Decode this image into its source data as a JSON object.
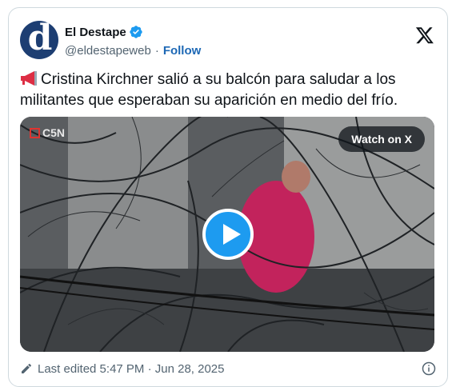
{
  "author": {
    "display_name": "El Destape",
    "handle": "@eldestapeweb",
    "follow_label": "Follow",
    "avatar_glyph": "d"
  },
  "tweet": {
    "text": "Cristina Kirchner salió a su balcón para saludar a los militantes que esperaban su aparición en medio del frío.",
    "emoji": "megaphone-icon"
  },
  "media": {
    "channel_label": "C5N",
    "watch_label": "Watch on X"
  },
  "footer": {
    "edited_label": "Last edited 5:47 PM · Jun 28, 2025"
  },
  "colors": {
    "accent": "#1d9bf0",
    "link": "#1d68b5",
    "muted": "#536471",
    "avatar_bg": "#1d3e72"
  }
}
